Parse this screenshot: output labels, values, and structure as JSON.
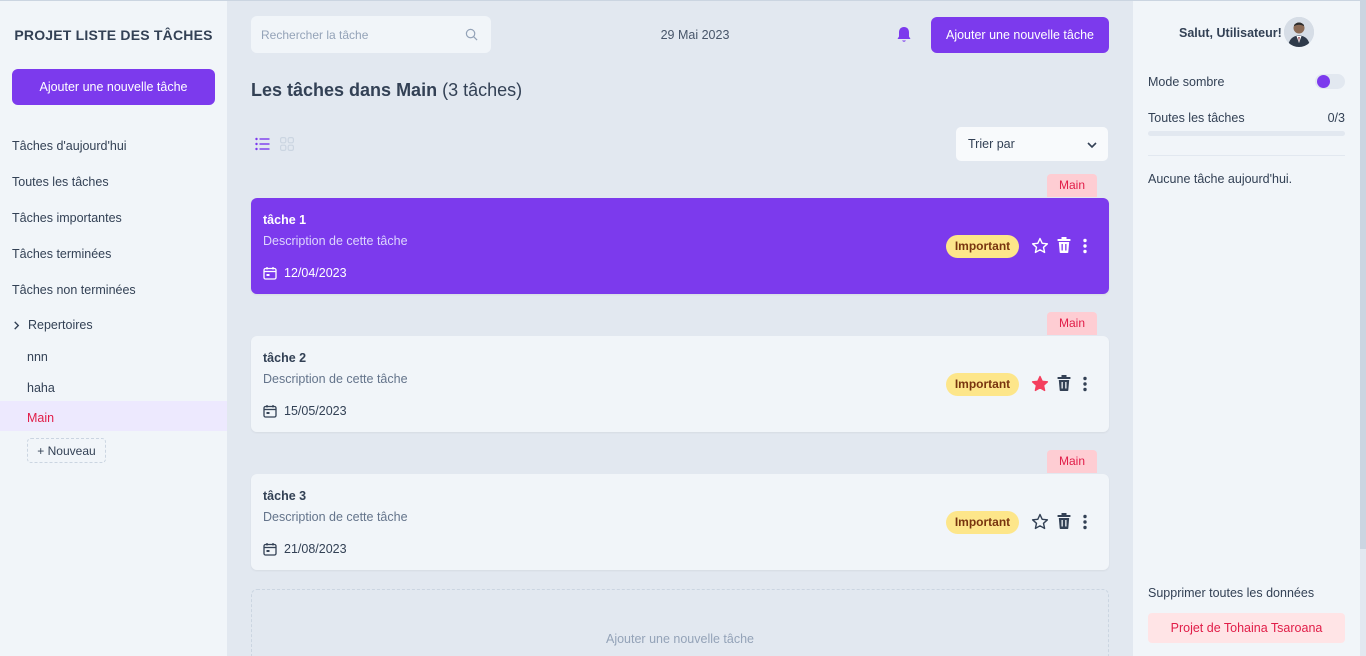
{
  "app": {
    "title": "PROJET LISTE DES TÂCHES"
  },
  "sidebar": {
    "add_button": "Ajouter une nouvelle tâche",
    "nav": [
      "Tâches d'aujourd'hui",
      "Toutes les tâches",
      "Tâches importantes",
      "Tâches terminées",
      "Tâches non terminées"
    ],
    "directories_label": "Repertoires",
    "directories": [
      "nnn",
      "haha",
      "Main"
    ],
    "active_directory": "Main",
    "new_button": "+ Nouveau"
  },
  "header": {
    "search_placeholder": "Rechercher la tâche",
    "date": "29 Mai 2023",
    "add_button": "Ajouter une nouvelle tâche"
  },
  "main": {
    "heading_prefix": "Les tâches dans Main",
    "heading_count": "(3 tâches)",
    "sort_label": "Trier par",
    "add_area": "Ajouter une nouvelle tâche",
    "tasks": [
      {
        "title": "tâche 1",
        "description": "Description de cette tâche",
        "date": "12/04/2023",
        "directory": "Main",
        "badge": "Important",
        "starred": false,
        "completed": true
      },
      {
        "title": "tâche 2",
        "description": "Description de cette tâche",
        "date": "15/05/2023",
        "directory": "Main",
        "badge": "Important",
        "starred": true,
        "completed": false
      },
      {
        "title": "tâche 3",
        "description": "Description de cette tâche",
        "date": "21/08/2023",
        "directory": "Main",
        "badge": "Important",
        "starred": false,
        "completed": false
      }
    ]
  },
  "right_panel": {
    "greeting": "Salut, Utilisateur!",
    "dark_mode_label": "Mode sombre",
    "dark_mode_on": true,
    "all_tasks_label": "Toutes les tâches",
    "all_tasks_count": "0/3",
    "progress_fraction": 0,
    "no_task_today": "Aucune tâche aujourd'hui.",
    "delete_all_label": "Supprimer toutes les données",
    "project_button": "Projet de Tohaina Tsaroana"
  },
  "colors": {
    "accent": "#7c3aed",
    "important_badge": "#fde68a",
    "directory_tag": "#fecdd3",
    "active_red": "#e11d48"
  },
  "icons": {
    "search": "search-icon",
    "notification": "bell-icon",
    "list_view": "list-view-icon",
    "grid_view": "grid-view-icon",
    "calendar": "calendar-icon",
    "star": "star-icon",
    "delete": "trash-icon",
    "more": "more-vertical-icon",
    "expand": "chevron-right-icon"
  }
}
